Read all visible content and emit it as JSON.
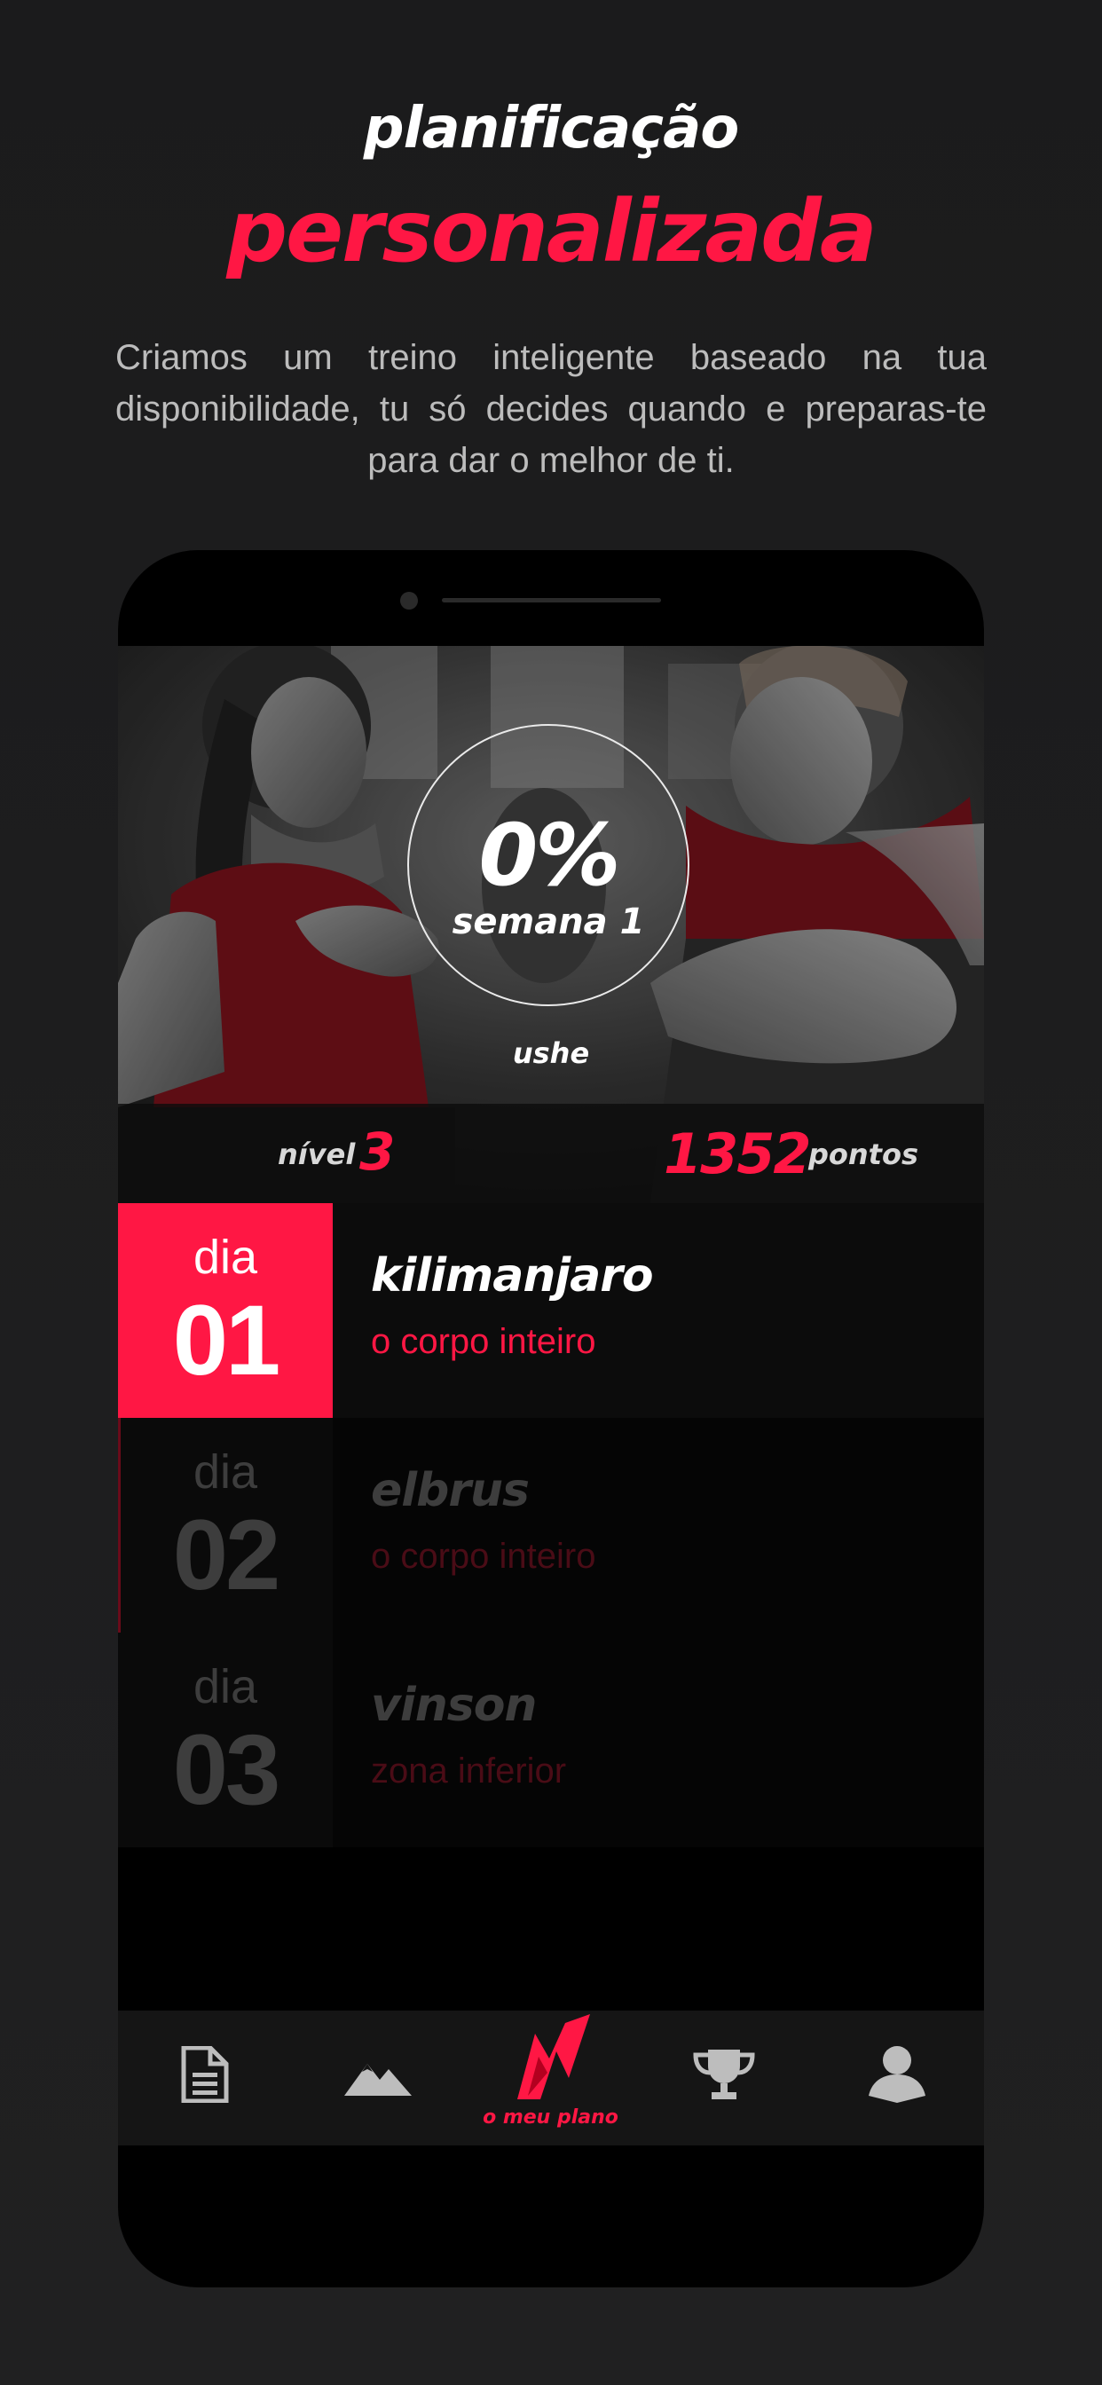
{
  "promo": {
    "title_line1": "planificação",
    "title_line2": "personalizada",
    "description": "Criamos um treino inteligente baseado na tua disponibilidade, tu só decides quando e preparas-te para dar o melhor de ti."
  },
  "colors": {
    "accent": "#ff1744",
    "background": "#1c1c1d",
    "screen": "#000000"
  },
  "hero": {
    "progress": "0%",
    "week": "semana 1",
    "username": "ushe",
    "level_label": "nível",
    "level_value": "3",
    "points_value": "1352",
    "points_label": "pontos"
  },
  "days": [
    {
      "label": "dia",
      "number": "01",
      "name": "kilimanjaro",
      "focus": "o corpo inteiro",
      "active": true
    },
    {
      "label": "dia",
      "number": "02",
      "name": "elbrus",
      "focus": "o corpo inteiro",
      "active": false
    },
    {
      "label": "dia",
      "number": "03",
      "name": "vinson",
      "focus": "zona inferior",
      "active": false
    }
  ],
  "nav": {
    "items": [
      {
        "icon": "document-icon"
      },
      {
        "icon": "mountains-icon"
      },
      {
        "icon": "plan-logo-icon",
        "label": "o meu plano",
        "active": true
      },
      {
        "icon": "trophy-icon"
      },
      {
        "icon": "profile-icon"
      }
    ]
  }
}
